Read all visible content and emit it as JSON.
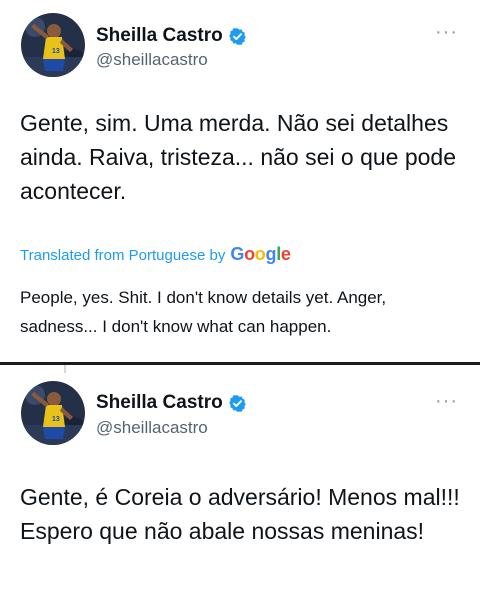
{
  "tweets": [
    {
      "author_name": "Sheilla Castro",
      "handle": "@sheillacastro",
      "text": "Gente, sim. Uma merda. Não sei detalhes ainda. Raiva, tristeza... não sei o que pode acontecer.",
      "translated_label": "Translated from Portuguese by",
      "translation_provider": "Google",
      "translation": "People, yes. Shit. I don't know details yet. Anger, sadness... I don't know what can happen."
    },
    {
      "author_name": "Sheilla Castro",
      "handle": "@sheillacastro",
      "text": "Gente, é Coreia o adversário! Menos mal!!! Espero que não abale nossas meninas!"
    }
  ],
  "more_menu_glyph": "···",
  "icons": {
    "verified": "verified-badge-icon",
    "more": "more-options-icon"
  },
  "colors": {
    "verified_blue": "#1d9bf0",
    "link_blue": "#1d9bf0",
    "handle_gray": "#536471",
    "google_blue": "#4285F4",
    "google_red": "#EA4335",
    "google_yellow": "#FBBC05",
    "google_green": "#34A853"
  }
}
